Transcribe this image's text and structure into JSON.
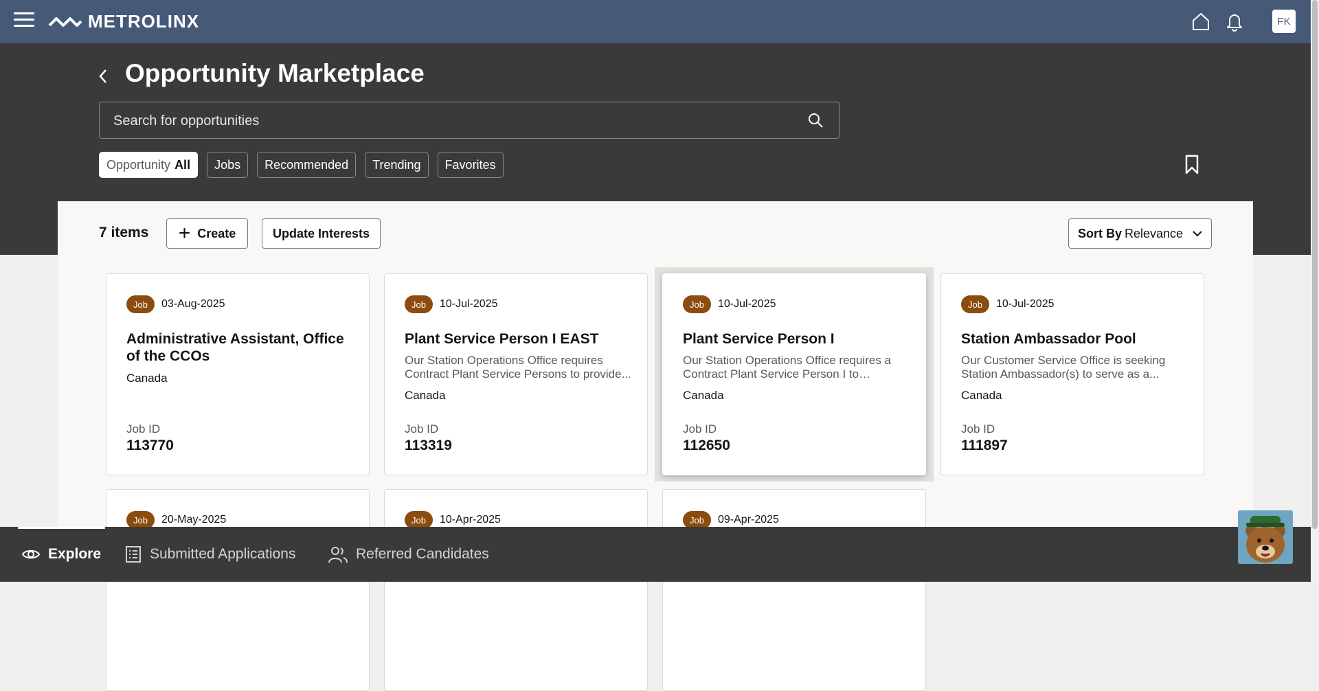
{
  "header": {
    "brand": "METROLINX",
    "avatar_initials": "FK",
    "icons": [
      "menu-icon",
      "home-icon",
      "bell-icon"
    ]
  },
  "page": {
    "title": "Opportunity Marketplace",
    "search_placeholder": "Search for opportunities"
  },
  "filters": [
    {
      "muted": "Opportunity",
      "label": "All",
      "active": true
    },
    {
      "label": "Jobs"
    },
    {
      "label": "Recommended"
    },
    {
      "label": "Trending"
    },
    {
      "label": "Favorites"
    }
  ],
  "toolbar": {
    "items_count": "7 items",
    "create_label": "Create",
    "update_interests_label": "Update Interests",
    "sort_label": "Sort By",
    "sort_value": "Relevance"
  },
  "cards": [
    {
      "badge": "Job",
      "date": "03-Aug-2025",
      "title": "Administrative Assistant, Office of the CCOs",
      "description": "",
      "location": "Canada",
      "id_label": "Job ID",
      "id": "113770"
    },
    {
      "badge": "Job",
      "date": "10-Jul-2025",
      "title": "Plant Service Person I EAST",
      "description": "Our Station Operations Office requires Contract Plant Service Persons to provide...",
      "location": "Canada",
      "id_label": "Job ID",
      "id": "113319"
    },
    {
      "badge": "Job",
      "date": "10-Jul-2025",
      "title": "Plant Service Person I",
      "description": "Our Station Operations Office requires a Contract Plant Service Person I to provide...",
      "location": "Canada",
      "id_label": "Job ID",
      "id": "112650"
    },
    {
      "badge": "Job",
      "date": "10-Jul-2025",
      "title": "Station Ambassador Pool",
      "description": "Our Customer Service Office is seeking Station Ambassador(s) to serve as a...",
      "location": "Canada",
      "id_label": "Job ID",
      "id": "111897"
    },
    {
      "badge": "Job",
      "date": "20-May-2025"
    },
    {
      "badge": "Job",
      "date": "10-Apr-2025"
    },
    {
      "badge": "Job",
      "date": "09-Apr-2025"
    }
  ],
  "bottom_nav": [
    {
      "label": "Explore",
      "icon": "eye-icon",
      "active": true
    },
    {
      "label": "Submitted Applications",
      "icon": "list-icon"
    },
    {
      "label": "Referred Candidates",
      "icon": "people-icon"
    }
  ],
  "colors": {
    "topbar": "#465a78",
    "header_band": "#3a3a3a",
    "badge": "#8b4c0d"
  }
}
